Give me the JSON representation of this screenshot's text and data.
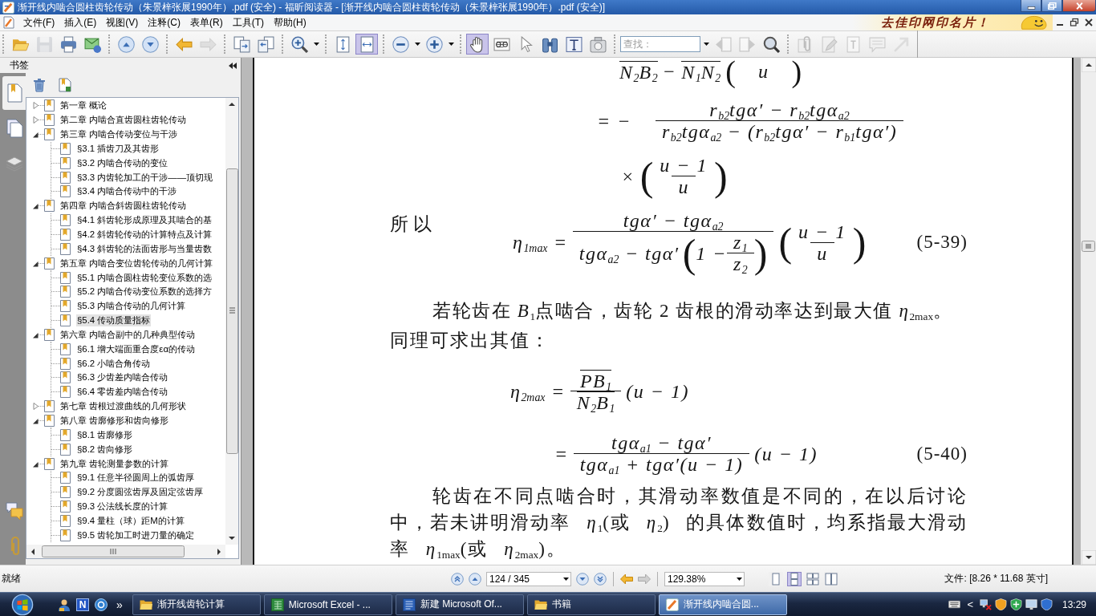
{
  "window": {
    "title": "渐开线内啮合圆柱齿轮传动（朱景梓张展1990年）.pdf (安全) - 福昕阅读器 - [渐开线内啮合圆柱齿轮传动（朱景梓张展1990年）.pdf (安全)]"
  },
  "menu": [
    "文件(F)",
    "插入(E)",
    "视图(V)",
    "注释(C)",
    "表单(R)",
    "工具(T)",
    "帮助(H)"
  ],
  "ad_banner": {
    "text": "去佳印网印名片！"
  },
  "toolbar": {
    "groups": [
      [
        {
          "kind": "open",
          "selected": false,
          "disabled": false
        },
        {
          "kind": "save",
          "selected": false,
          "disabled": true
        },
        {
          "kind": "print",
          "selected": false,
          "disabled": false
        },
        {
          "kind": "mail",
          "selected": false,
          "disabled": false
        }
      ],
      [
        {
          "kind": "up",
          "selected": false,
          "disabled": false
        },
        {
          "kind": "down",
          "selected": false,
          "disabled": false
        }
      ],
      [
        {
          "kind": "back",
          "selected": false,
          "disabled": false
        },
        {
          "kind": "forward",
          "selected": false,
          "disabled": true
        }
      ],
      [
        {
          "kind": "extract",
          "selected": false,
          "disabled": false
        },
        {
          "kind": "insert",
          "selected": false,
          "disabled": false
        }
      ],
      [
        {
          "kind": "zoom",
          "selected": false,
          "disabled": false
        },
        {
          "kind": "caret"
        }
      ],
      [
        {
          "kind": "fitpage",
          "selected": false,
          "disabled": false
        },
        {
          "kind": "fitwidth",
          "selected": true,
          "disabled": false
        }
      ],
      [
        {
          "kind": "zoomout",
          "selected": false,
          "disabled": false
        },
        {
          "kind": "caret"
        },
        {
          "kind": "zoomin",
          "selected": false,
          "disabled": false
        },
        {
          "kind": "caret"
        }
      ],
      [
        {
          "kind": "hand",
          "selected": true,
          "disabled": false
        },
        {
          "kind": "select",
          "selected": false,
          "disabled": false
        },
        {
          "kind": "pointer",
          "selected": false,
          "disabled": false
        },
        {
          "kind": "binoculars",
          "selected": false,
          "disabled": false
        },
        {
          "kind": "typewriter",
          "selected": false,
          "disabled": false
        },
        {
          "kind": "snapshot",
          "selected": false,
          "disabled": false
        }
      ],
      [
        {
          "kind": "search",
          "placeholder": "查找："
        },
        {
          "kind": "caret"
        },
        {
          "kind": "findprev",
          "selected": false,
          "disabled": true
        },
        {
          "kind": "findnext",
          "selected": false,
          "disabled": true
        },
        {
          "kind": "findall",
          "selected": false,
          "disabled": false
        }
      ],
      [
        {
          "kind": "attach",
          "selected": false,
          "disabled": true
        },
        {
          "kind": "pencil",
          "selected": false,
          "disabled": true
        },
        {
          "kind": "textbox",
          "selected": false,
          "disabled": true
        },
        {
          "kind": "note",
          "selected": false,
          "disabled": true
        },
        {
          "kind": "arrow",
          "selected": false,
          "disabled": true
        }
      ]
    ]
  },
  "sidebar": {
    "title": "书签",
    "tabs": [
      {
        "kind": "bookmarks",
        "selected": true
      },
      {
        "kind": "pages",
        "selected": false
      },
      {
        "kind": "layers",
        "selected": false
      },
      {
        "kind": "comments",
        "selected": false
      },
      {
        "kind": "attachments",
        "selected": false
      }
    ],
    "bookmarks": [
      {
        "label": "第一章 概论",
        "expanded": false,
        "selected": false
      },
      {
        "label": "第二章 内啮合直齿圆柱齿轮传动",
        "expanded": false,
        "selected": false
      },
      {
        "label": "第三章 内啮合传动变位与干涉",
        "expanded": true,
        "selected": false,
        "children": [
          {
            "label": "§3.1 插齿刀及其齿形",
            "selected": false
          },
          {
            "label": "§3.2 内啮合传动的变位",
            "selected": false
          },
          {
            "label": "§3.3 内齿轮加工的干涉——顶切现",
            "selected": false
          },
          {
            "label": "§3.4 内啮合传动中的干涉",
            "selected": false
          }
        ]
      },
      {
        "label": "第四章 内啮合斜齿圆柱齿轮传动",
        "expanded": true,
        "selected": false,
        "children": [
          {
            "label": "§4.1 斜齿轮形成原理及其啮合的基",
            "selected": false
          },
          {
            "label": "§4.2 斜齿轮传动的计算特点及计算",
            "selected": false
          },
          {
            "label": "§4.3 斜齿轮的法面齿形与当量齿数",
            "selected": false
          }
        ]
      },
      {
        "label": "第五章 内啮合变位齿轮传动的几何计算",
        "expanded": true,
        "selected": false,
        "children": [
          {
            "label": "§5.1 内啮合圆柱齿轮变位系数的选",
            "selected": false
          },
          {
            "label": "§5.2 内啮合传动变位系数的选择方",
            "selected": false
          },
          {
            "label": "§5.3 内啮合传动的几何计算",
            "selected": false
          },
          {
            "label": "§5.4 传动质量指标",
            "selected": true
          }
        ]
      },
      {
        "label": "第六章 内啮合副中的几种典型传动",
        "expanded": true,
        "selected": false,
        "children": [
          {
            "label": "§6.1 增大端面重合度εα的传动",
            "selected": false
          },
          {
            "label": "§6.2 小啮合角传动",
            "selected": false
          },
          {
            "label": "§6.3 少齿差内啮合传动",
            "selected": false
          },
          {
            "label": "§6.4 零齿差内啮合传动",
            "selected": false
          }
        ]
      },
      {
        "label": "第七章 齿根过渡曲线的几何形状",
        "expanded": false,
        "selected": false
      },
      {
        "label": "第八章 齿廓修形和齿向修形",
        "expanded": true,
        "selected": false,
        "children": [
          {
            "label": "§8.1 齿廓修形",
            "selected": false
          },
          {
            "label": "§8.2 齿向修形",
            "selected": false
          }
        ]
      },
      {
        "label": "第九章 齿轮测量参数的计算",
        "expanded": true,
        "selected": false,
        "children": [
          {
            "label": "§9.1 任意半径圆周上的弧齿厚",
            "selected": false
          },
          {
            "label": "§9.2 分度圆弦齿厚及固定弦齿厚",
            "selected": false
          },
          {
            "label": "§9.3 公法线长度的计算",
            "selected": false
          },
          {
            "label": "§9.4 量柱（球）距M的计算",
            "selected": false
          },
          {
            "label": "§9.5 齿轮加工时进刀量的确定",
            "selected": false
          }
        ]
      }
    ]
  },
  "document": {
    "blocks": [
      {
        "kind": "formula",
        "parts": [
          {
            "kind": "bar",
            "text": "N$_{2}$B$_{2}$"
          },
          {
            "kind": "text",
            "text": "−"
          },
          {
            "kind": "bar",
            "text": "N$_{1}$N$_{2}$"
          },
          {
            "kind": "paren",
            "open": "(",
            "close": ")",
            "items": [
              {
                "kind": "text",
                "text": "u"
              }
            ]
          }
        ]
      },
      {
        "kind": "formula",
        "parts": [
          {
            "kind": "text",
            "text": "= −"
          },
          {
            "kind": "frac",
            "num": [
              {
                "kind": "text",
                "text": "r$_{b2}$tgα′ − r$_{b2}$tgα$_{a2}$"
              }
            ],
            "den": [
              {
                "kind": "text",
                "text": "r$_{b2}$tgα$_{a2}$ − (r$_{b2}$tgα′ − r$_{b1}$tgα′)"
              }
            ]
          }
        ]
      },
      {
        "kind": "formula",
        "parts": [
          {
            "kind": "text",
            "text": "×"
          },
          {
            "kind": "paren",
            "open": "(",
            "close": ")",
            "items": [
              {
                "kind": "frac",
                "num": [
                  {
                    "kind": "text",
                    "text": "u − 1"
                  }
                ],
                "den": [
                  {
                    "kind": "text",
                    "text": "u"
                  }
                ]
              }
            ]
          }
        ]
      },
      {
        "kind": "formula",
        "lead": "所以",
        "parts": [
          {
            "kind": "text",
            "text": "η$_{1max}$ ="
          },
          {
            "kind": "frac",
            "num": [
              {
                "kind": "text",
                "text": "tgα′ − tgα$_{a2}$"
              }
            ],
            "den": [
              {
                "kind": "text",
                "text": "tgα$_{a2}$ − tgα′"
              },
              {
                "kind": "paren",
                "open": "(",
                "close": ")",
                "items": [
                  {
                    "kind": "text",
                    "text": "1 −"
                  },
                  {
                    "kind": "frac",
                    "num": [
                      {
                        "kind": "text",
                        "text": "z$_{1}$"
                      }
                    ],
                    "den": [
                      {
                        "kind": "text",
                        "text": "z$_{2}$"
                      }
                    ]
                  }
                ]
              }
            ]
          },
          {
            "kind": "paren",
            "open": "(",
            "close": ")",
            "items": [
              {
                "kind": "frac",
                "num": [
                  {
                    "kind": "text",
                    "text": "u − 1"
                  }
                ],
                "den": [
                  {
                    "kind": "text",
                    "text": "u"
                  }
                ]
              }
            ]
          }
        ],
        "number": "(5-39)"
      },
      {
        "kind": "paragraph",
        "text": "若轮齿在 *B*$_{1}$点啮合，齿轮 2 齿根的滑动率达到最大值 *η*$_{2max}$。"
      },
      {
        "kind": "line",
        "text": "同理可求出其值："
      },
      {
        "kind": "formula",
        "parts": [
          {
            "kind": "text",
            "text": "η$_{2max}$ ="
          },
          {
            "kind": "frac",
            "num": [
              {
                "kind": "bar",
                "text": "PB$_{1}$"
              }
            ],
            "den": [
              {
                "kind": "bar",
                "text": "N$_{2}$B$_{1}$"
              }
            ]
          },
          {
            "kind": "text",
            "text": "(u − 1)"
          }
        ]
      },
      {
        "kind": "formula",
        "parts": [
          {
            "kind": "text",
            "text": "="
          },
          {
            "kind": "frac",
            "num": [
              {
                "kind": "text",
                "text": "tgα$_{a1}$ − tgα′"
              }
            ],
            "den": [
              {
                "kind": "text",
                "text": "tgα$_{a1}$ + tgα′(u − 1)"
              }
            ]
          },
          {
            "kind": "text",
            "text": "(u − 1)"
          }
        ],
        "number": "(5-40)"
      },
      {
        "kind": "paragraph",
        "text": "轮齿在不同点啮合时，其滑动率数值是不同的，在以后讨论中，若未讲明滑动率 *η*$_{1}$(或 *η*$_{2}$) 的具体数值时，均系指最大滑动率 *η*$_{1max}$(或 *η*$_{2max}$)。"
      }
    ]
  },
  "status_bar": {
    "status": "就绪",
    "page": "124 / 345",
    "history": [
      {
        "kind": "back",
        "disabled": false
      },
      {
        "kind": "forward",
        "disabled": true
      }
    ],
    "zoom": "129.38%",
    "view_modes": [
      {
        "kind": "single",
        "selected": false
      },
      {
        "kind": "continuous",
        "selected": true
      },
      {
        "kind": "facing",
        "selected": false
      },
      {
        "kind": "continuousfacing",
        "selected": false
      }
    ],
    "file_info": "文件: [8.26 * 11.68 英寸]"
  },
  "taskbar": {
    "quick_launch": [
      {
        "kind": "person"
      },
      {
        "kind": "tile",
        "text": "N"
      },
      {
        "kind": "disc"
      }
    ],
    "more": "»",
    "tasks": [
      {
        "kind": "folder",
        "label": "渐开线齿轮计算",
        "selected": false
      },
      {
        "kind": "excel",
        "label": "Microsoft Excel - ...",
        "selected": false
      },
      {
        "kind": "word",
        "label": "新建 Microsoft Of...",
        "selected": false
      },
      {
        "kind": "folder",
        "label": "书籍",
        "selected": false
      },
      {
        "kind": "reader",
        "label": "渐开线内啮合圆...",
        "selected": true
      }
    ],
    "tray_toggle": "<",
    "clock": "13:29"
  }
}
